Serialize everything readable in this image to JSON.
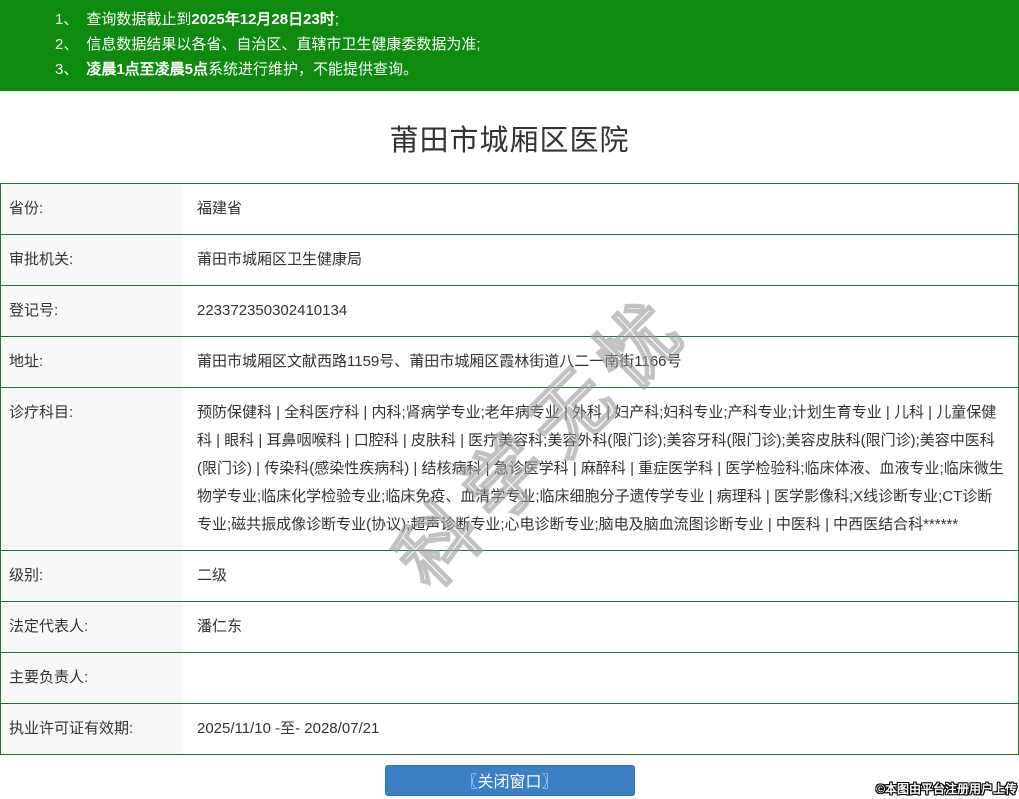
{
  "notice": {
    "lines": [
      {
        "num": "1、",
        "pre": "查询数据截止到",
        "bold": "2025年12月28日23时",
        "post": ";"
      },
      {
        "num": "2、",
        "pre": "信息数据结果以各省、自治区、直辖市卫生健康委数据为准;",
        "bold": "",
        "post": ""
      },
      {
        "num": "3、",
        "pre": "",
        "bold": "凌晨1点至凌晨5点",
        "post": "系统进行维护，不能提供查询。"
      }
    ]
  },
  "main": {
    "title": "莆田市城厢区医院"
  },
  "table": {
    "rows": [
      {
        "label": "省份:",
        "value": "福建省"
      },
      {
        "label": "审批机关:",
        "value": "莆田市城厢区卫生健康局"
      },
      {
        "label": "登记号:",
        "value": "223372350302410134"
      },
      {
        "label": "地址:",
        "value": "莆田市城厢区文献西路1159号、莆田市城厢区霞林街道八二一南街1166号"
      },
      {
        "label": "诊疗科目:",
        "value": "预防保健科 | 全科医疗科 | 内科;肾病学专业;老年病专业 | 外科 | 妇产科;妇科专业;产科专业;计划生育专业 | 儿科 | 儿童保健科 | 眼科 | 耳鼻咽喉科 | 口腔科 | 皮肤科 | 医疗美容科;美容外科(限门诊);美容牙科(限门诊);美容皮肤科(限门诊);美容中医科(限门诊) | 传染科(感染性疾病科) | 结核病科 | 急诊医学科 | 麻醉科 | 重症医学科 | 医学检验科;临床体液、血液专业;临床微生物学专业;临床化学检验专业;临床免疫、血清学专业;临床细胞分子遗传学专业 | 病理科 | 医学影像科;X线诊断专业;CT诊断专业;磁共振成像诊断专业(协议);超声诊断专业;心电诊断专业;脑电及脑血流图诊断专业 | 中医科 | 中西医结合科******"
      },
      {
        "label": "级别:",
        "value": "二级"
      },
      {
        "label": "法定代表人:",
        "value": "潘仁东"
      },
      {
        "label": "主要负责人:",
        "value": ""
      },
      {
        "label": "执业许可证有效期:",
        "value": "2025/11/10 -至- 2028/07/21"
      }
    ]
  },
  "watermark": {
    "text": "科学无忧"
  },
  "footer": {
    "close_button_label": "〖关闭窗口〗",
    "upload_note": "©本图由平台注册用户上传"
  },
  "colors": {
    "banner_green": "#0e8a0e",
    "table_border_green": "#2a6e35",
    "label_cell_bg": "#f8f8f8",
    "button_blue": "#3b7fc4",
    "text": "#333333"
  }
}
